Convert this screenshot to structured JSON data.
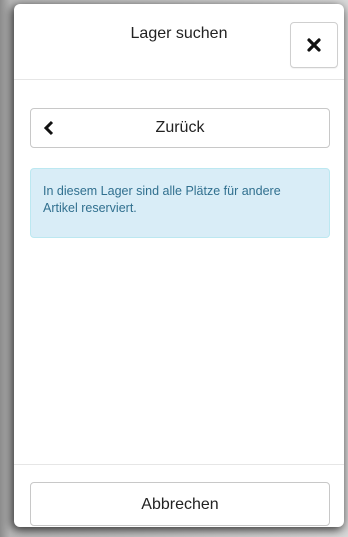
{
  "modal": {
    "title": "Lager suchen",
    "back_label": "Zurück",
    "info_message": "In diesem Lager sind alle Plätze für andere Artikel reserviert.",
    "cancel_label": "Abbrechen"
  },
  "colors": {
    "info_background": "#d9edf7",
    "info_border": "#bce8f1",
    "info_text": "#31708f"
  },
  "icons": {
    "close": "close-icon",
    "back": "chevron-left-icon"
  }
}
